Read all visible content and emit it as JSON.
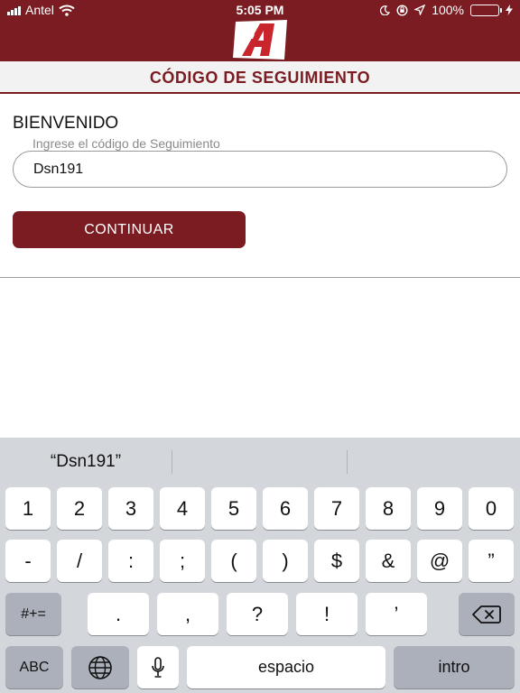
{
  "status": {
    "carrier": "Antel",
    "time": "5:05 PM",
    "battery": "100%"
  },
  "header": {
    "title": "CÓDIGO DE SEGUIMIENTO"
  },
  "form": {
    "welcome": "BIENVENIDO",
    "field_label": "Ingrese el código de Seguimiento",
    "code_value": "Dsn191",
    "continue_label": "CONTINUAR"
  },
  "keyboard": {
    "suggestion": "“Dsn191”",
    "row1": [
      "1",
      "2",
      "3",
      "4",
      "5",
      "6",
      "7",
      "8",
      "9",
      "0"
    ],
    "row2": [
      "-",
      "/",
      ":",
      ";",
      "(",
      ")",
      "$",
      "&",
      "@",
      "”"
    ],
    "row3": [
      ".",
      ",",
      "?",
      "!",
      "’"
    ],
    "symbols_label": "#+=",
    "abc_label": "ABC",
    "space_label": "espacio",
    "return_label": "intro"
  },
  "colors": {
    "brand": "#7a1c22",
    "battery": "#4cd964",
    "keyboard_bg": "#d3d6db"
  },
  "icons": {
    "wifi": "wifi-icon",
    "moon": "moon-icon",
    "rotation_lock": "rotation-lock-icon",
    "location": "location-icon",
    "charging": "charging-icon",
    "globe": "globe-icon",
    "microphone": "microphone-icon",
    "backspace": "backspace-icon"
  }
}
